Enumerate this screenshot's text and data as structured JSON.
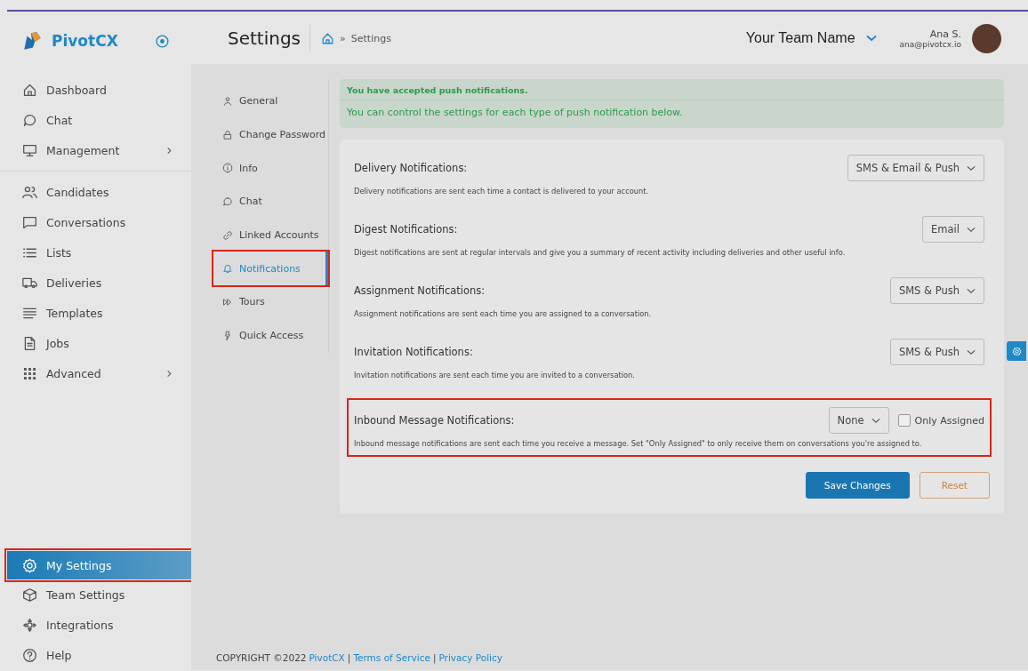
{
  "brand": {
    "name": "PivotCX"
  },
  "sidebar": {
    "groups": [
      {
        "items": [
          {
            "label": "Dashboard",
            "selected": false,
            "highlighted": false,
            "has_submenu": false
          },
          {
            "label": "Chat",
            "selected": false,
            "highlighted": false,
            "has_submenu": false
          },
          {
            "label": "Management",
            "selected": false,
            "highlighted": false,
            "has_submenu": true
          }
        ]
      },
      {
        "items": [
          {
            "label": "Candidates",
            "selected": false,
            "highlighted": false,
            "has_submenu": false
          },
          {
            "label": "Conversations",
            "selected": false,
            "highlighted": false,
            "has_submenu": false
          },
          {
            "label": "Lists",
            "selected": false,
            "highlighted": false,
            "has_submenu": false
          },
          {
            "label": "Deliveries",
            "selected": false,
            "highlighted": false,
            "has_submenu": false
          },
          {
            "label": "Templates",
            "selected": false,
            "highlighted": false,
            "has_submenu": false
          },
          {
            "label": "Jobs",
            "selected": false,
            "highlighted": false,
            "has_submenu": false
          },
          {
            "label": "Advanced",
            "selected": false,
            "highlighted": false,
            "has_submenu": true
          }
        ]
      },
      {
        "items": [
          {
            "label": "My Settings",
            "selected": true,
            "highlighted": true,
            "has_submenu": false
          },
          {
            "label": "Team Settings",
            "selected": false,
            "highlighted": false,
            "has_submenu": false
          },
          {
            "label": "Integrations",
            "selected": false,
            "highlighted": false,
            "has_submenu": false
          },
          {
            "label": "Help",
            "selected": false,
            "highlighted": false,
            "has_submenu": false
          }
        ]
      }
    ]
  },
  "header": {
    "title": "Settings",
    "breadcrumb": [
      "»",
      "Settings"
    ],
    "team": "Your Team Name",
    "user": {
      "name": "Ana S.",
      "email": "ana@pivotcx.io"
    }
  },
  "settings_nav": [
    {
      "label": "General",
      "selected": false,
      "highlighted": false
    },
    {
      "label": "Change Password",
      "selected": false,
      "highlighted": false
    },
    {
      "label": "Info",
      "selected": false,
      "highlighted": false
    },
    {
      "label": "Chat",
      "selected": false,
      "highlighted": false
    },
    {
      "label": "Linked Accounts",
      "selected": false,
      "highlighted": false
    },
    {
      "label": "Notifications",
      "selected": true,
      "highlighted": true
    },
    {
      "label": "Tours",
      "selected": false,
      "highlighted": false
    },
    {
      "label": "Quick Access",
      "selected": false,
      "highlighted": false
    }
  ],
  "alert": {
    "title": "You have accepted push notifications.",
    "message": "You can control the settings for each type of push notification below."
  },
  "notifications": [
    {
      "title": "Delivery Notifications:",
      "description": "Delivery notifications are sent each time a contact is delivered to your account.",
      "value": "SMS & Email & Push",
      "highlighted": false
    },
    {
      "title": "Digest Notifications:",
      "description": "Digest notifications are sent at regular intervals and give you a summary of recent activity including deliveries and other useful info.",
      "value": "Email",
      "highlighted": false
    },
    {
      "title": "Assignment Notifications:",
      "description": "Assignment notifications are sent each time you are assigned to a conversation.",
      "value": "SMS & Push",
      "highlighted": false
    },
    {
      "title": "Invitation Notifications:",
      "description": "Invitation notifications are sent each time you are invited to a conversation.",
      "value": "SMS & Push",
      "highlighted": false
    },
    {
      "title": "Inbound Message Notifications:",
      "description": "Inbound message notifications are sent each time you receive a message. Set \"Only Assigned\" to only receive them on conversations you're assigned to.",
      "value": "None",
      "highlighted": true,
      "option": {
        "label": "Only Assigned",
        "checked": false
      }
    }
  ],
  "buttons": [
    {
      "label": "Save Changes",
      "kind": "primary"
    },
    {
      "label": "Reset",
      "kind": "secondary"
    }
  ],
  "footer": {
    "copyright": "COPYRIGHT ©2022",
    "links": [
      "PivotCX",
      "|",
      "Terms of Service",
      "|",
      "Privacy Policy"
    ]
  }
}
